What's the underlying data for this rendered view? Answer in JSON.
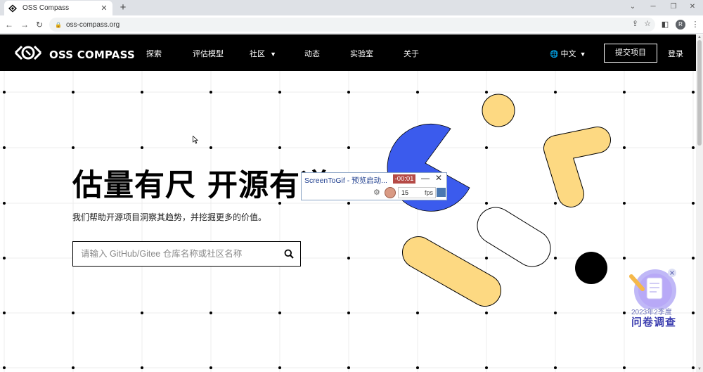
{
  "browser": {
    "tab_title": "OSS Compass",
    "url": "oss-compass.org",
    "profile_initial": "R"
  },
  "site": {
    "logo_text": "OSS COMPASS",
    "nav": [
      "探索",
      "评估模型",
      "社区",
      "动态",
      "实验室",
      "关于"
    ],
    "language": "中文",
    "submit_label": "提交项目",
    "login_label": "登录"
  },
  "hero": {
    "headline": "估量有尺 开源有道",
    "subtitle": "我们帮助开源项目洞察其趋势，并挖掘更多的价值。",
    "search_placeholder": "请输入 GitHub/Gitee 仓库名称或社区名称"
  },
  "survey": {
    "year": "2023年2季度",
    "title": "问卷调查"
  },
  "screentogif": {
    "title": "ScreenToGif - 预览启动...",
    "timer": "-00:01",
    "fps_value": "15",
    "fps_unit": "fps"
  },
  "colors": {
    "accent_blue": "#3b5bed",
    "accent_yellow": "#fdd982",
    "nav_bg": "#000000"
  }
}
